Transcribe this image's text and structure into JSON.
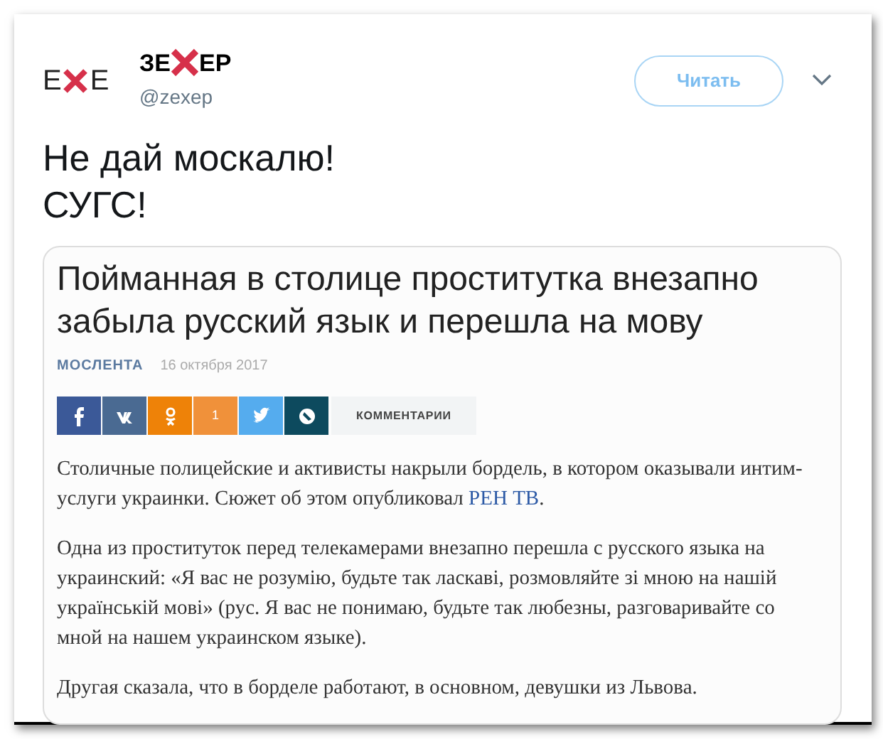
{
  "tweet": {
    "avatar": {
      "left": "E",
      "right": "E"
    },
    "display_name": {
      "left": "ЗЕ",
      "right": "ЕР"
    },
    "handle": "@zexep",
    "follow_button": "Читать",
    "text_lines": [
      "Не дай москалю!",
      "СУГС!"
    ],
    "article": {
      "title": "Пойманная в столице проститутка внезапно забыла русский язык и перешла на мову",
      "source": "МОСЛЕНТА",
      "date": "16 октября 2017",
      "share_buttons": [
        {
          "kind": "facebook",
          "color": "#3b5998"
        },
        {
          "kind": "vk",
          "color": "#4a6a92"
        },
        {
          "kind": "odnoklassniki",
          "color": "#ee8208"
        },
        {
          "kind": "count",
          "color": "#f0913a",
          "label": "1"
        },
        {
          "kind": "twitter",
          "color": "#55acee"
        },
        {
          "kind": "livejournal",
          "color": "#0d4a5e"
        }
      ],
      "comments_button": "КОММЕНТАРИИ",
      "paragraphs": [
        {
          "before": "Столичные полицейские и активисты накрыли бордель, в котором оказывали интим-услуги украинки. Сюжет об этом опубликовал ",
          "link": "РЕН ТВ",
          "after": "."
        },
        {
          "before": "Одна из проституток перед телекамерами внезапно перешла с русского языка на украинский: «Я вас не розумію, будьте так ласкаві, розмовляйте зі мною на нашій українській мові» (рус. Я вас не понимаю, будьте так любезны, разговаривайте со мной на нашем украинском языке)."
        },
        {
          "before": "Другая сказала, что в борделе работают, в основном, девушки из Львова."
        }
      ]
    }
  }
}
